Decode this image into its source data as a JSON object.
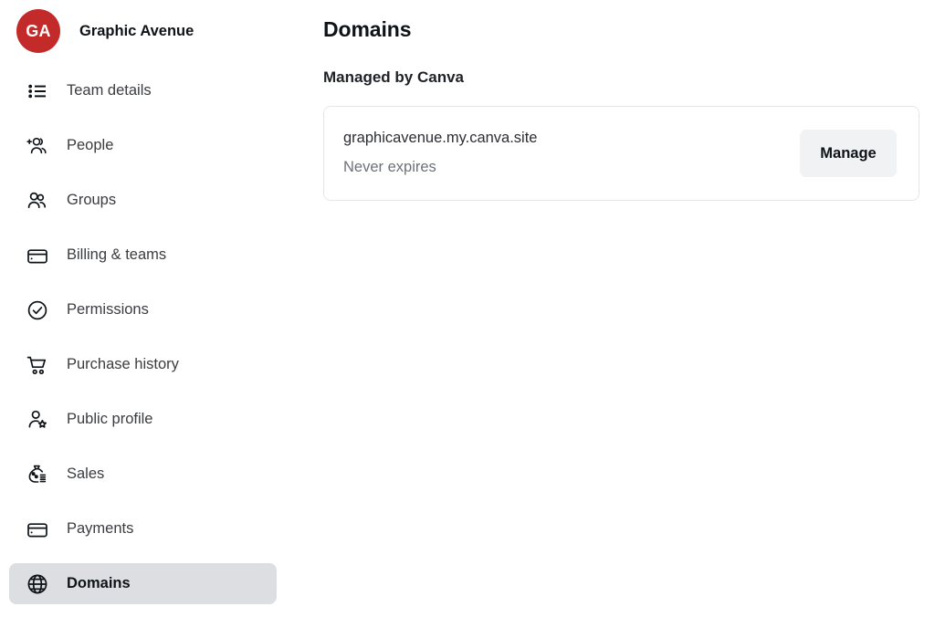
{
  "brand": {
    "avatar_initials": "GA",
    "name": "Graphic Avenue",
    "avatar_color": "#C32B2B"
  },
  "sidebar": {
    "items": [
      {
        "label": "Team details",
        "icon": "list-bullet-icon",
        "selected": false
      },
      {
        "label": "People",
        "icon": "people-add-icon",
        "selected": false
      },
      {
        "label": "Groups",
        "icon": "groups-icon",
        "selected": false
      },
      {
        "label": "Billing & teams",
        "icon": "credit-card-icon",
        "selected": false
      },
      {
        "label": "Permissions",
        "icon": "check-circle-icon",
        "selected": false
      },
      {
        "label": "Purchase history",
        "icon": "shopping-cart-icon",
        "selected": false
      },
      {
        "label": "Public profile",
        "icon": "person-star-icon",
        "selected": false
      },
      {
        "label": "Sales",
        "icon": "money-bag-icon",
        "selected": false
      },
      {
        "label": "Payments",
        "icon": "credit-card-icon",
        "selected": false
      },
      {
        "label": "Domains",
        "icon": "globe-icon",
        "selected": true
      }
    ],
    "scrollbar": {
      "track_color": "#F2F2F2",
      "thumb_color": "#BEBEBE"
    }
  },
  "main": {
    "title": "Domains",
    "subtitle": "Managed by Canva",
    "domains": [
      {
        "name": "graphicavenue.my.canva.site",
        "expiry": "Never expires",
        "action_label": "Manage"
      }
    ]
  }
}
